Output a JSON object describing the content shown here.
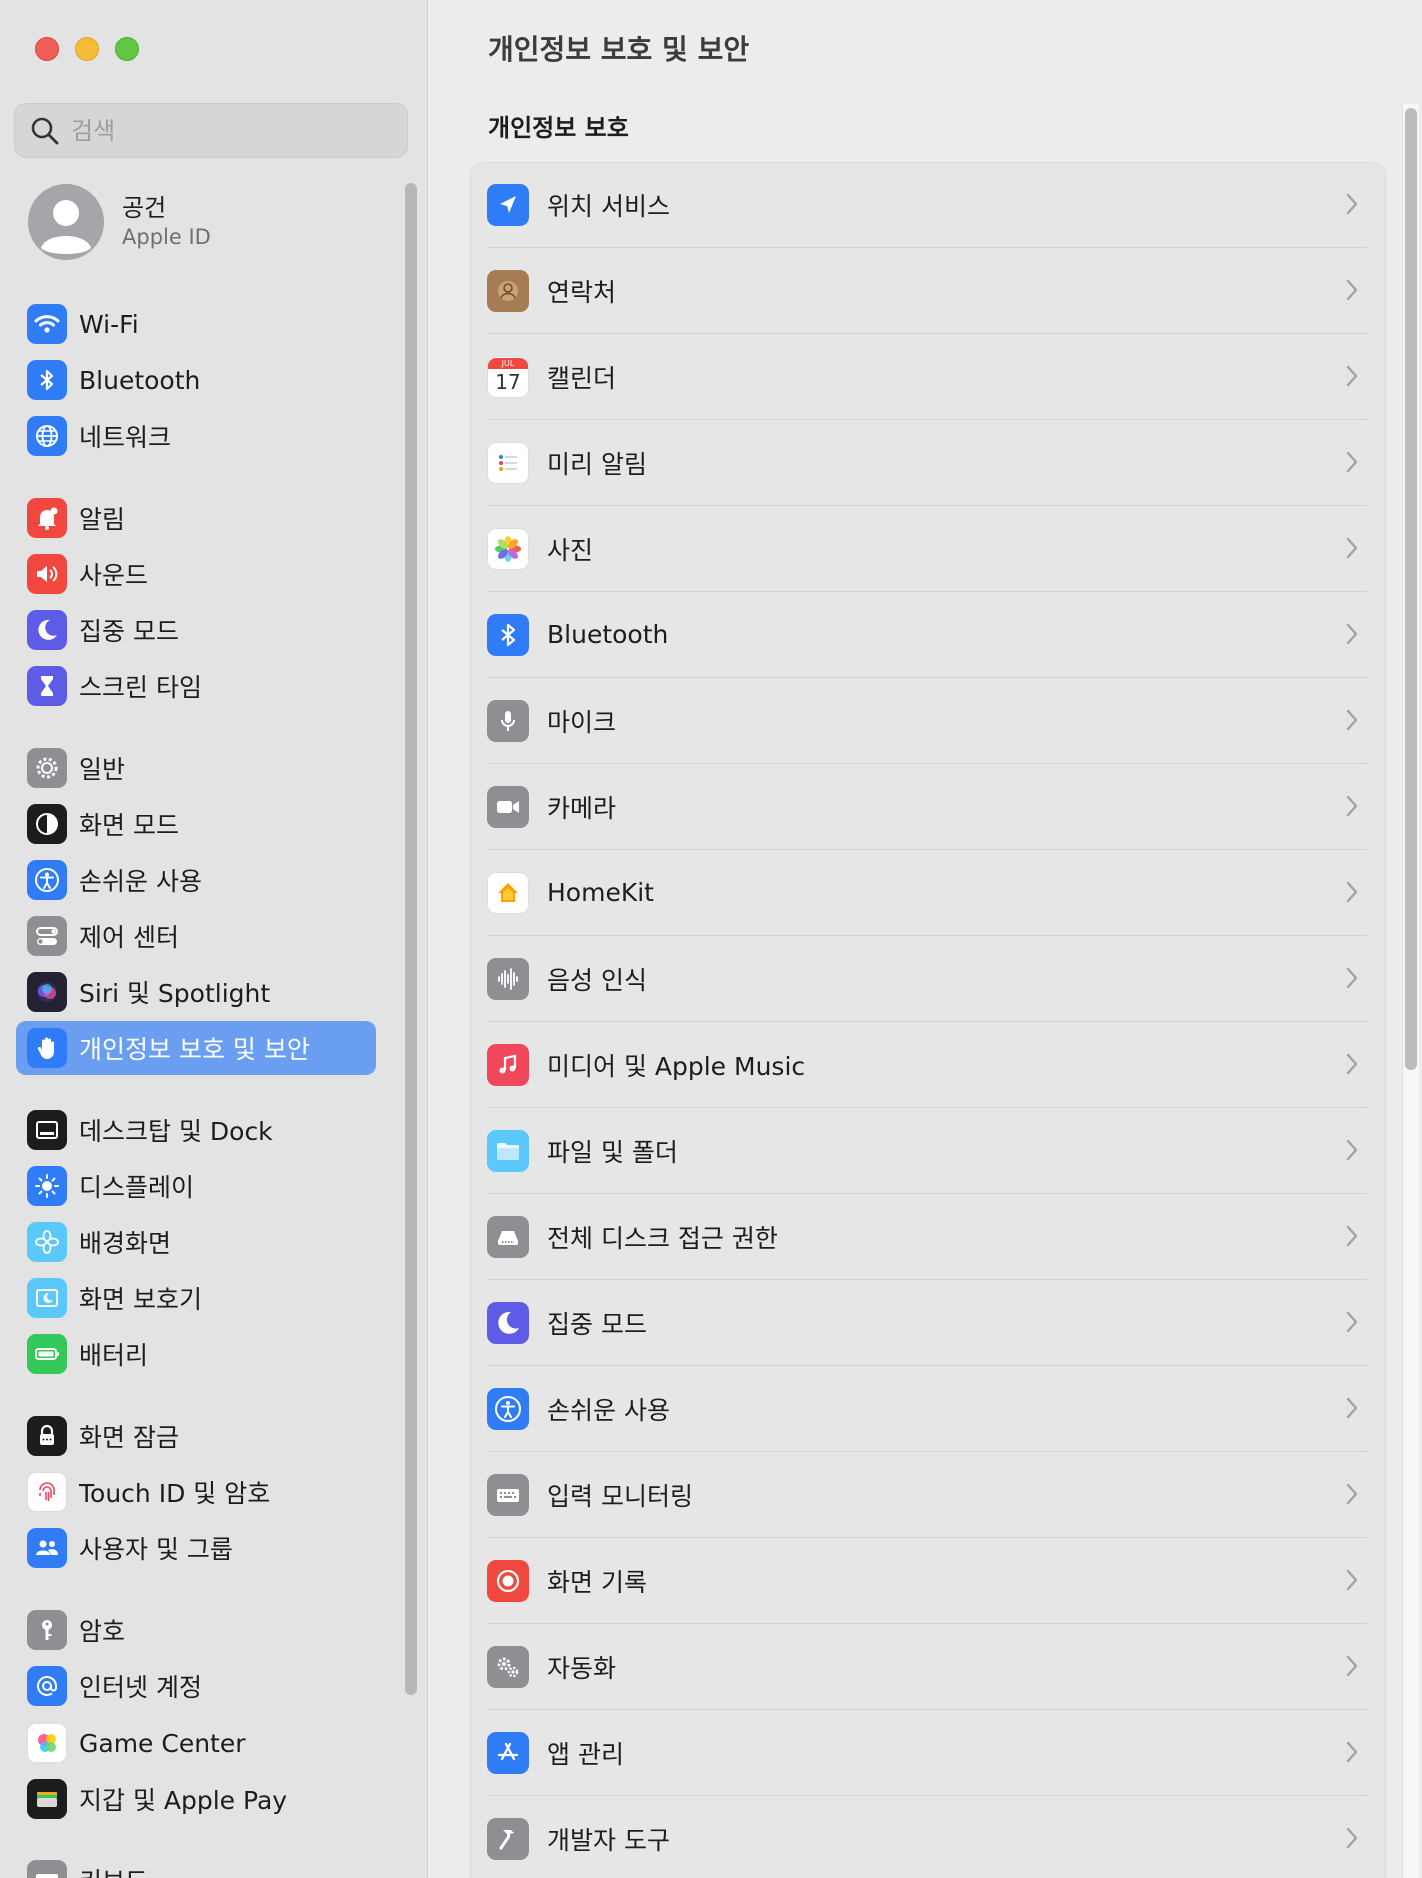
{
  "window": {
    "traffic_lights": [
      "close",
      "minimize",
      "zoom"
    ]
  },
  "sidebar": {
    "search": {
      "placeholder": "검색",
      "value": ""
    },
    "account": {
      "name": "공건",
      "subtitle": "Apple ID"
    },
    "items": [
      {
        "label": "Wi-Fi",
        "icon": "wifi-icon",
        "color": "#2f7cf6"
      },
      {
        "label": "Bluetooth",
        "icon": "bluetooth-icon",
        "color": "#2f7cf6"
      },
      {
        "label": "네트워크",
        "icon": "globe-icon",
        "color": "#2f7cf6"
      },
      {
        "label": "알림",
        "icon": "bell-icon",
        "color": "#f0483e"
      },
      {
        "label": "사운드",
        "icon": "speaker-icon",
        "color": "#f0483e"
      },
      {
        "label": "집중 모드",
        "icon": "moon-icon",
        "color": "#5e5ce6"
      },
      {
        "label": "스크린 타임",
        "icon": "hourglass-icon",
        "color": "#5e5ce6"
      },
      {
        "label": "일반",
        "icon": "gear-icon",
        "color": "#8e8e93"
      },
      {
        "label": "화면 모드",
        "icon": "appearance-icon",
        "color": "#1c1c1e"
      },
      {
        "label": "손쉬운 사용",
        "icon": "accessibility-icon",
        "color": "#2f7cf6"
      },
      {
        "label": "제어 센터",
        "icon": "control-center-icon",
        "color": "#8e8e93"
      },
      {
        "label": "Siri 및 Spotlight",
        "icon": "siri-icon",
        "color": "#222233"
      },
      {
        "label": "개인정보 보호 및 보안",
        "icon": "hand-icon",
        "color": "#2f7cf6",
        "active": true
      },
      {
        "label": "데스크탑 및 Dock",
        "icon": "dock-icon",
        "color": "#1c1c1e"
      },
      {
        "label": "디스플레이",
        "icon": "sun-icon",
        "color": "#2f7cf6"
      },
      {
        "label": "배경화면",
        "icon": "flower-icon",
        "color": "#5ac8fa"
      },
      {
        "label": "화면 보호기",
        "icon": "screensaver-icon",
        "color": "#5ac8fa"
      },
      {
        "label": "배터리",
        "icon": "battery-icon",
        "color": "#34c759"
      },
      {
        "label": "화면 잠금",
        "icon": "lock-icon",
        "color": "#1c1c1e"
      },
      {
        "label": "Touch ID 및 암호",
        "icon": "fingerprint-icon",
        "color": "#ffffff"
      },
      {
        "label": "사용자 및 그룹",
        "icon": "users-icon",
        "color": "#2f7cf6"
      },
      {
        "label": "암호",
        "icon": "key-icon",
        "color": "#8e8e93"
      },
      {
        "label": "인터넷 계정",
        "icon": "at-icon",
        "color": "#2f7cf6"
      },
      {
        "label": "Game Center",
        "icon": "game-center-icon",
        "color": "#ffffff"
      },
      {
        "label": "지갑 및 Apple Pay",
        "icon": "wallet-icon",
        "color": "#1c1c1e"
      },
      {
        "label": "키보드",
        "icon": "keyboard-icon",
        "color": "#8e8e93"
      }
    ]
  },
  "main": {
    "title": "개인정보 보호 및 보안",
    "section_title": "개인정보 보호",
    "rows": [
      {
        "label": "위치 서비스",
        "icon": "location-arrow-icon",
        "color": "#2f7cf6"
      },
      {
        "label": "연락처",
        "icon": "contacts-icon",
        "color": "#a67c52"
      },
      {
        "label": "캘린더",
        "icon": "calendar-icon",
        "color": "#ffffff",
        "month": "JUL",
        "day": "17"
      },
      {
        "label": "미리 알림",
        "icon": "reminders-icon",
        "color": "#ffffff"
      },
      {
        "label": "사진",
        "icon": "photos-icon",
        "color": "#ffffff"
      },
      {
        "label": "Bluetooth",
        "icon": "bluetooth-icon",
        "color": "#2f7cf6"
      },
      {
        "label": "마이크",
        "icon": "microphone-icon",
        "color": "#8e8e93"
      },
      {
        "label": "카메라",
        "icon": "camera-icon",
        "color": "#8e8e93"
      },
      {
        "label": "HomeKit",
        "icon": "home-icon",
        "color": "#ffffff"
      },
      {
        "label": "음성 인식",
        "icon": "waveform-icon",
        "color": "#8e8e93"
      },
      {
        "label": "미디어 및 Apple Music",
        "icon": "music-note-icon",
        "color": "#f0485a"
      },
      {
        "label": "파일 및 폴더",
        "icon": "folder-icon",
        "color": "#5ac8fa"
      },
      {
        "label": "전체 디스크 접근 권한",
        "icon": "disk-icon",
        "color": "#8e8e93"
      },
      {
        "label": "집중 모드",
        "icon": "moon-icon",
        "color": "#5e5ce6"
      },
      {
        "label": "손쉬운 사용",
        "icon": "accessibility-icon",
        "color": "#2f7cf6"
      },
      {
        "label": "입력 모니터링",
        "icon": "keyboard-icon",
        "color": "#8e8e93"
      },
      {
        "label": "화면 기록",
        "icon": "screen-record-icon",
        "color": "#f0483e"
      },
      {
        "label": "자동화",
        "icon": "gears-icon",
        "color": "#8e8e93"
      },
      {
        "label": "앱 관리",
        "icon": "app-store-icon",
        "color": "#2f7cf6"
      },
      {
        "label": "개발자 도구",
        "icon": "hammer-icon",
        "color": "#8e8e93"
      }
    ]
  }
}
